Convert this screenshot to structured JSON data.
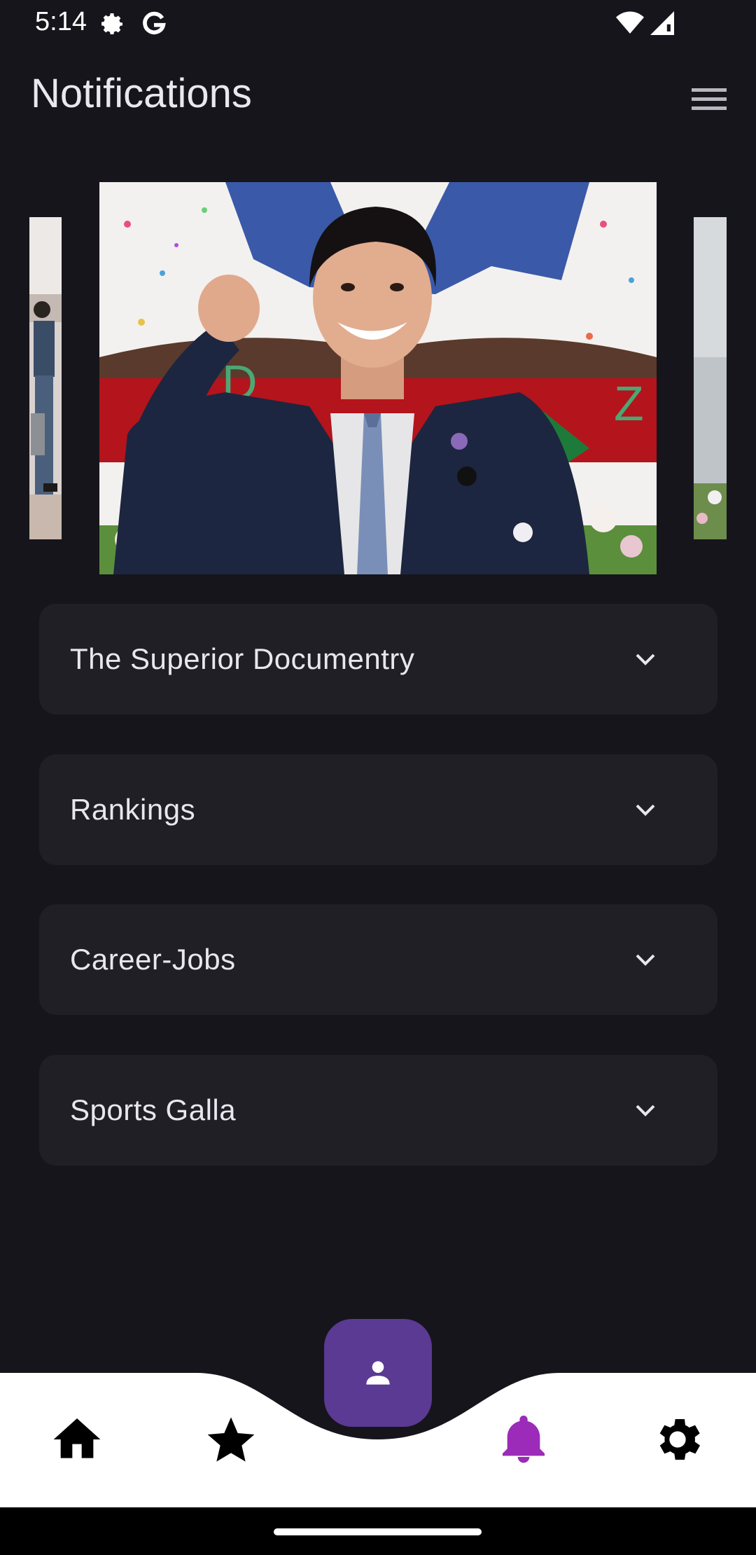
{
  "status_bar": {
    "time": "5:14",
    "icons": [
      "settings-gear-icon",
      "google-g-icon",
      "wifi-icon",
      "cell-signal-icon"
    ]
  },
  "app_bar": {
    "title": "Notifications",
    "menu_icon": "hamburger-menu-icon"
  },
  "carousel": {
    "images": [
      "left-partial-photo",
      "graduate-celebrating-photo",
      "right-partial-photo"
    ]
  },
  "sections": [
    {
      "title": "The Superior Documentry"
    },
    {
      "title": "Rankings"
    },
    {
      "title": "Career-Jobs"
    },
    {
      "title": "Sports Galla"
    }
  ],
  "bottom_nav": {
    "items": [
      {
        "icon": "home-icon"
      },
      {
        "icon": "star-icon"
      },
      {
        "icon": "bell-icon",
        "active": true
      },
      {
        "icon": "gear-icon"
      }
    ],
    "fab_icon": "person-icon",
    "active_color": "#9b2bb8",
    "fab_color": "#5a3a92"
  },
  "colors": {
    "background": "#16151b",
    "card": "#211f26",
    "nav_background": "#ffffff"
  }
}
